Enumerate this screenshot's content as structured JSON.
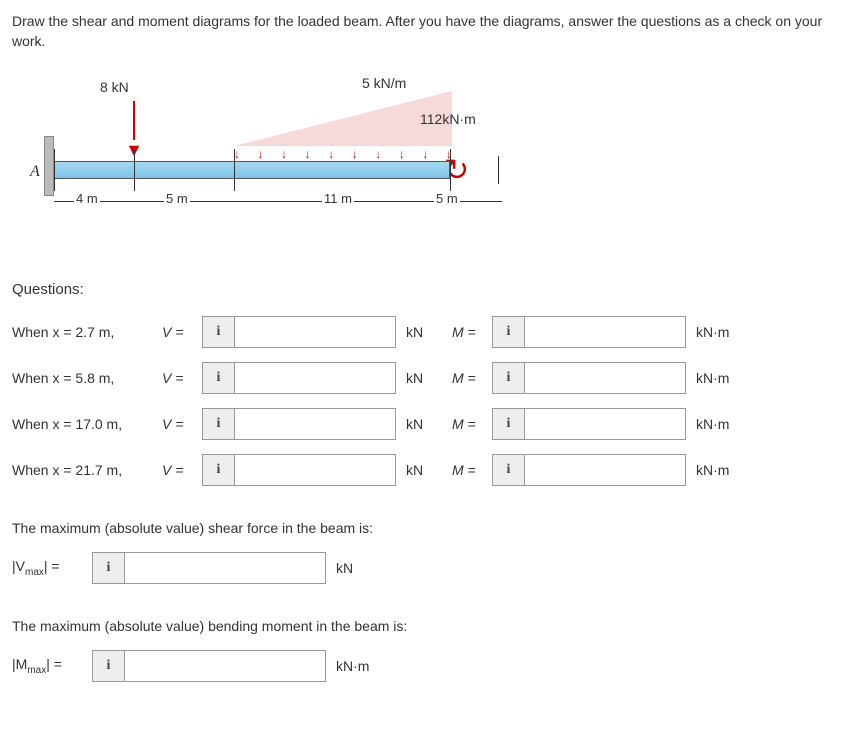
{
  "instructions": "Draw the shear and moment diagrams for the loaded beam. After you have the diagrams, answer the questions as a check on your work.",
  "diagram": {
    "point_load": "8 kN",
    "dist_load": "5 kN/m",
    "moment": "112kN·m",
    "label_A": "A",
    "dim1": "4 m",
    "dim2": "5 m",
    "dim3": "11 m",
    "dim4": "5 m"
  },
  "questions_heading": "Questions:",
  "rows": [
    {
      "x": "When x = 2.7 m,",
      "V": "V =",
      "unitV": "kN",
      "M": "M =",
      "unitM": "kN·m"
    },
    {
      "x": "When x = 5.8 m,",
      "V": "V =",
      "unitV": "kN",
      "M": "M =",
      "unitM": "kN·m"
    },
    {
      "x": "When x = 17.0 m,",
      "V": "V =",
      "unitV": "kN",
      "M": "M =",
      "unitM": "kN·m"
    },
    {
      "x": "When x = 21.7 m,",
      "V": "V =",
      "unitV": "kN",
      "M": "M =",
      "unitM": "kN·m"
    }
  ],
  "max_shear_text": "The maximum (absolute value) shear force in the beam is:",
  "vmax_label": "|Vmax| =",
  "vmax_unit": "kN",
  "max_moment_text": "The maximum (absolute value) bending moment in the beam is:",
  "mmax_label": "|Mmax| =",
  "mmax_unit": "kN·m",
  "info_icon": "i"
}
